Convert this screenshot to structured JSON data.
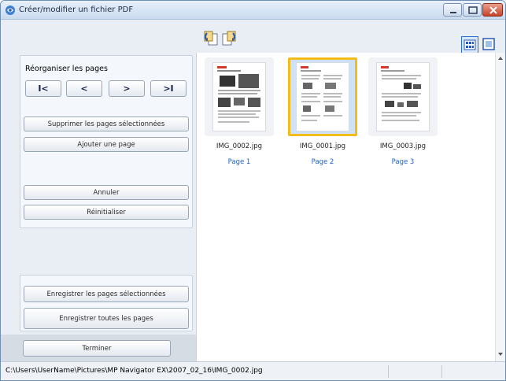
{
  "window": {
    "title": "Créer/modifier un fichier PDF"
  },
  "toolbar": {
    "rotate_left_icon": "rotate-left-icon",
    "rotate_right_icon": "rotate-right-icon",
    "view_thumbnails_icon": "view-thumbnails-icon",
    "view_single_icon": "view-single-page-icon"
  },
  "left_panel": {
    "reorder_label": "Réorganiser les pages",
    "first_label": "I<",
    "prev_label": "<",
    "next_label": ">",
    "last_label": ">I",
    "delete_selected_label": "Supprimer les pages sélectionnées",
    "add_page_label": "Ajouter une page",
    "undo_label": "Annuler",
    "reset_label": "Réinitialiser",
    "save_selected_label": "Enregistrer les pages sélectionnées",
    "save_all_label": "Enregistrer toutes les pages",
    "finish_label": "Terminer"
  },
  "pages": [
    {
      "filename": "IMG_0002.jpg",
      "label": "Page 1",
      "selected": false
    },
    {
      "filename": "IMG_0001.jpg",
      "label": "Page 2",
      "selected": true
    },
    {
      "filename": "IMG_0003.jpg",
      "label": "Page 3",
      "selected": false
    }
  ],
  "status": {
    "path": "C:\\Users\\UserName\\Pictures\\MP Navigator EX\\2007_02_16\\IMG_0002.jpg"
  },
  "colors": {
    "selection_border": "#f2bd1a",
    "selection_fill": "#cfe1f7",
    "page_label": "#1f5fc8",
    "close_button": "#c6432a"
  }
}
